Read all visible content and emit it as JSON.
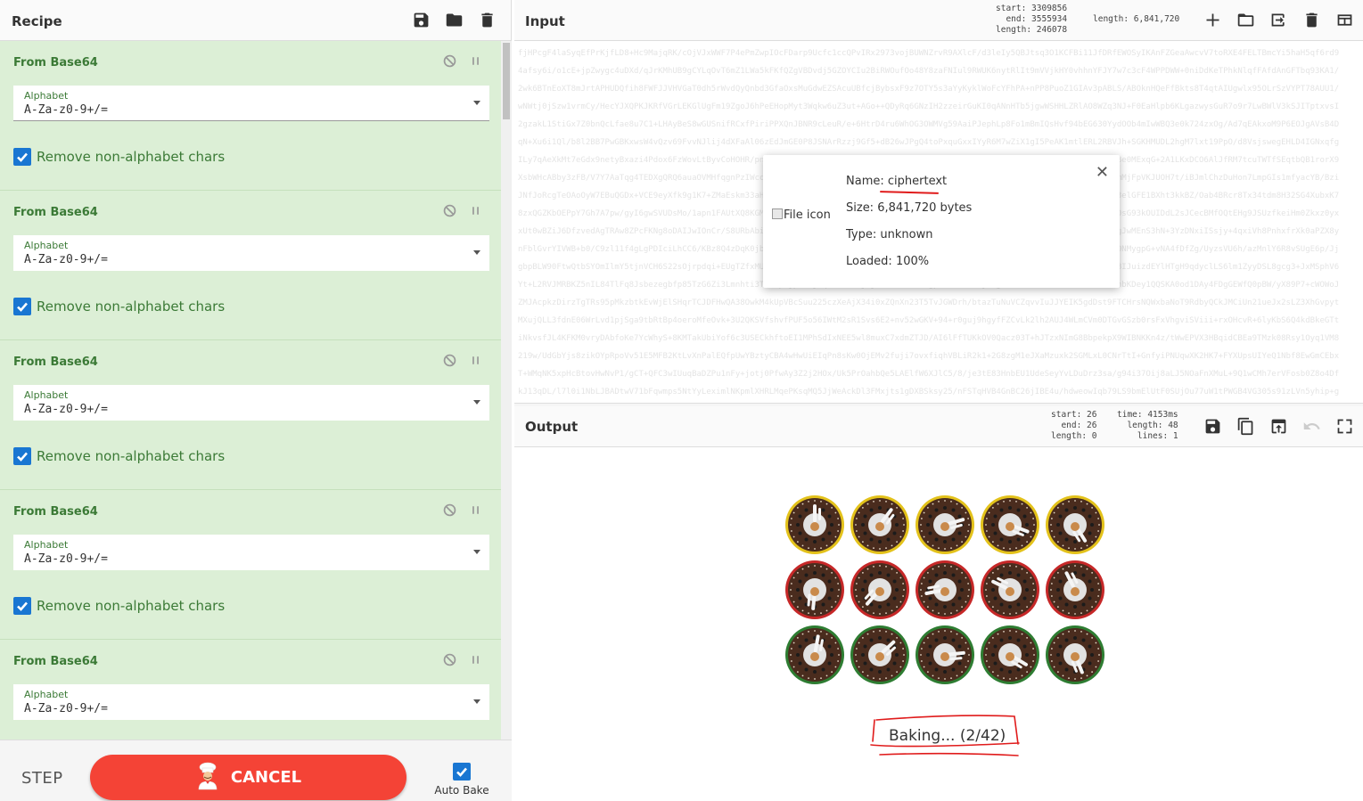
{
  "recipe": {
    "title": "Recipe",
    "icons": [
      "save-icon",
      "folder-icon",
      "trash-icon"
    ],
    "operations": [
      {
        "name": "From Base64",
        "alphabet_label": "Alphabet",
        "alphabet_value": "A-Za-z0-9+/=",
        "checkbox_label": "Remove non-alphabet chars",
        "checked": true
      },
      {
        "name": "From Base64",
        "alphabet_label": "Alphabet",
        "alphabet_value": "A-Za-z0-9+/=",
        "checkbox_label": "Remove non-alphabet chars",
        "checked": true
      },
      {
        "name": "From Base64",
        "alphabet_label": "Alphabet",
        "alphabet_value": "A-Za-z0-9+/=",
        "checkbox_label": "Remove non-alphabet chars",
        "checked": true
      },
      {
        "name": "From Base64",
        "alphabet_label": "Alphabet",
        "alphabet_value": "A-Za-z0-9+/=",
        "checkbox_label": "Remove non-alphabet chars",
        "checked": true
      },
      {
        "name": "From Base64",
        "alphabet_label": "Alphabet",
        "alphabet_value": "A-Za-z0-9+/=",
        "checkbox_label": "",
        "checked": true
      }
    ]
  },
  "controls": {
    "step_label": "STEP",
    "cancel_label": "CANCEL",
    "autobake_label": "Auto Bake",
    "autobake_checked": true
  },
  "input": {
    "title": "Input",
    "stats": {
      "start": "3309856",
      "end": "3555934",
      "length": "246078",
      "total_length": "6,841,720"
    },
    "file": {
      "icon_alt": "File icon",
      "name_label": "Name:",
      "name_value": "ciphertext",
      "size_label": "Size:",
      "size_value": "6,841,720 bytes",
      "type_label": "Type:",
      "type_value": "unknown",
      "loaded_label": "Loaded:",
      "loaded_value": "100%"
    }
  },
  "output": {
    "title": "Output",
    "stats": {
      "start": "26",
      "end": "26",
      "length": "0",
      "time": "4153ms",
      "out_length": "48",
      "lines": "1"
    },
    "baking_text": "Baking... (2/42)",
    "loader_ring_colors": [
      "#e3c21b",
      "#c62828",
      "#2e7d32"
    ]
  },
  "colors": {
    "op_bg": "#dcefd6",
    "op_text": "#3b7a36",
    "accent_blue": "#1976d2",
    "cancel_red": "#f44336"
  }
}
